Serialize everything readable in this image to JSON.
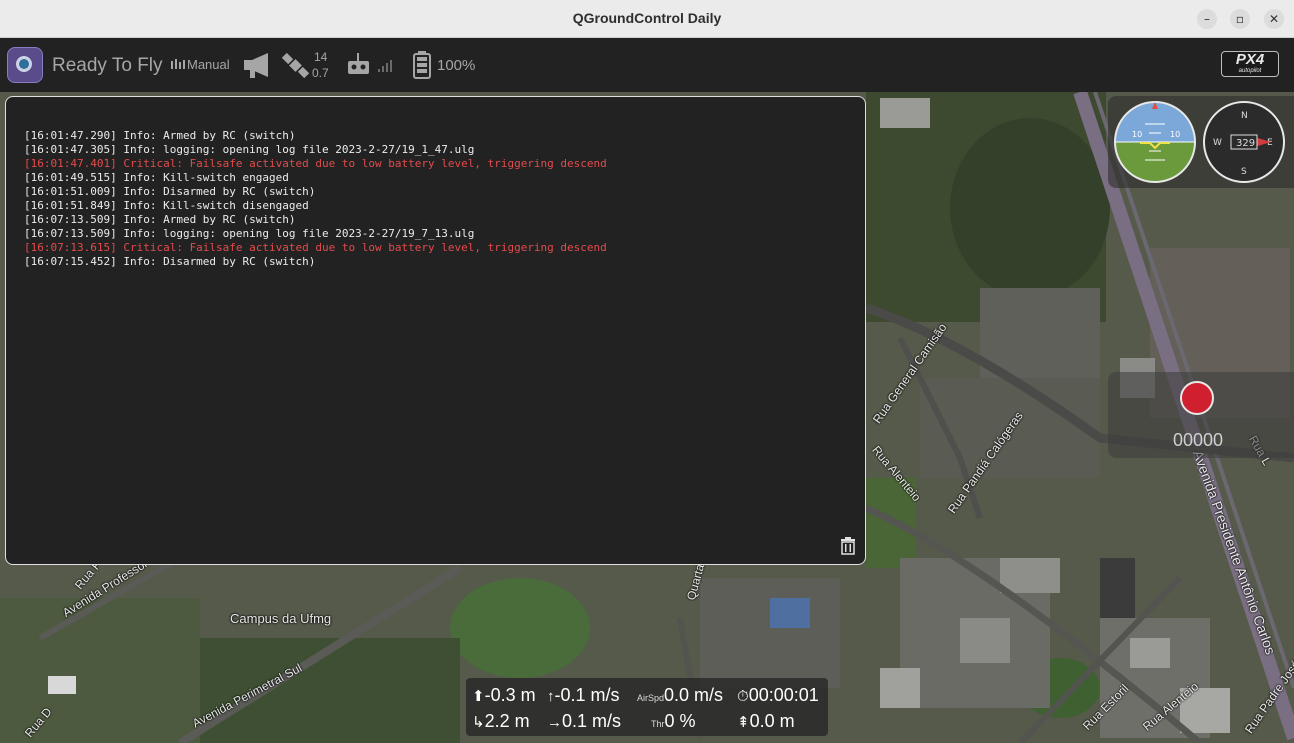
{
  "window": {
    "title": "QGroundControl Daily",
    "minimize_glyph": "–",
    "maximize_glyph": "▫",
    "close_glyph": "✕"
  },
  "toolbar": {
    "status": "Ready To Fly",
    "flight_mode": "Manual",
    "gps_sat_count": "14",
    "gps_hdop": "0.7",
    "battery": "100%",
    "logo_icon": "qgc-logo-icon",
    "px4_text": "PX4",
    "px4_subtext": "autopilot"
  },
  "messages": [
    {
      "text": "[16:01:47.290] Info: Armed by RC (switch)",
      "level": "info"
    },
    {
      "text": "[16:01:47.305] Info: logging: opening log file 2023-2-27/19_1_47.ulg",
      "level": "info"
    },
    {
      "text": "[16:01:47.401] Critical: Failsafe activated due to low battery level, triggering descend",
      "level": "critical"
    },
    {
      "text": "[16:01:49.515] Info: Kill-switch engaged",
      "level": "info"
    },
    {
      "text": "[16:01:51.009] Info: Disarmed by RC (switch)",
      "level": "info"
    },
    {
      "text": "[16:01:51.849] Info: Kill-switch disengaged",
      "level": "info"
    },
    {
      "text": "[16:07:13.509] Info: Armed by RC (switch)",
      "level": "info"
    },
    {
      "text": "[16:07:13.509] Info: logging: opening log file 2023-2-27/19_7_13.ulg",
      "level": "info"
    },
    {
      "text": "[16:07:13.615] Critical: Failsafe activated due to low battery level, triggering descend",
      "level": "critical"
    },
    {
      "text": "[16:07:15.452] Info: Disarmed by RC (switch)",
      "level": "info"
    }
  ],
  "instruments": {
    "pitch_scale": "10",
    "heading": "329",
    "compass": {
      "n": "N",
      "e": "E",
      "s": "S",
      "w": "W"
    }
  },
  "camera": {
    "record_count": "00000"
  },
  "telemetry": {
    "altitude": "-0.3 m",
    "vertical_speed": "-0.1 m/s",
    "airspeed_label": "AirSpd",
    "airspeed": "0.0 m/s",
    "flight_time": "00:00:01",
    "distance": "2.2 m",
    "ground_speed": "0.1 m/s",
    "throttle_label": "Thr",
    "throttle": "0 %",
    "home_distance": "0.0 m"
  },
  "map_labels": {
    "campus": "Campus da Ufmg",
    "av_professor": "Avenida Professor Ma",
    "av_perimetral": "Avenida Perimetral Sul",
    "rua_general": "Rua General Camisão",
    "rua_alenteio": "Rua Alenteio",
    "rua_pandia": "Rua Pandiá Calógeras",
    "av_presidente": "Avenida Presidente Antônio Carlos",
    "rua_estoril": "Rua Estoril",
    "rua_alenteio2": "Rua Alenteio",
    "rua_padre": "Rua Padre José",
    "rua_d": "Rua D",
    "rua_f": "Rua F",
    "quarta": "Quarta",
    "rua_l": "Rua L"
  },
  "colors": {
    "toolbar_bg": "#222222",
    "panel_bg": "#222222",
    "critical": "#e24b4b",
    "record": "#d01f2e"
  }
}
